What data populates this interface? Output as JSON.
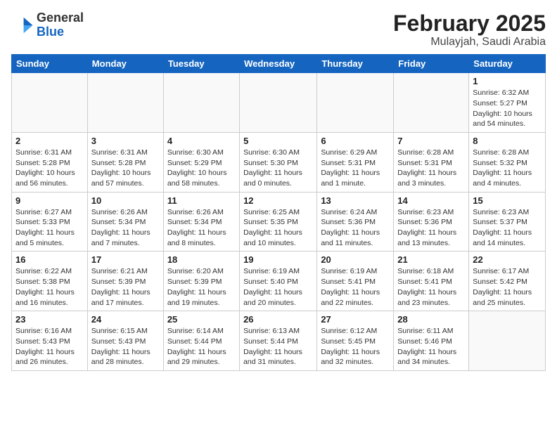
{
  "header": {
    "logo_general": "General",
    "logo_blue": "Blue",
    "title": "February 2025",
    "subtitle": "Mulayjah, Saudi Arabia"
  },
  "days_of_week": [
    "Sunday",
    "Monday",
    "Tuesday",
    "Wednesday",
    "Thursday",
    "Friday",
    "Saturday"
  ],
  "weeks": [
    [
      {
        "day": "",
        "info": ""
      },
      {
        "day": "",
        "info": ""
      },
      {
        "day": "",
        "info": ""
      },
      {
        "day": "",
        "info": ""
      },
      {
        "day": "",
        "info": ""
      },
      {
        "day": "",
        "info": ""
      },
      {
        "day": "1",
        "info": "Sunrise: 6:32 AM\nSunset: 5:27 PM\nDaylight: 10 hours and 54 minutes."
      }
    ],
    [
      {
        "day": "2",
        "info": "Sunrise: 6:31 AM\nSunset: 5:28 PM\nDaylight: 10 hours and 56 minutes."
      },
      {
        "day": "3",
        "info": "Sunrise: 6:31 AM\nSunset: 5:28 PM\nDaylight: 10 hours and 57 minutes."
      },
      {
        "day": "4",
        "info": "Sunrise: 6:30 AM\nSunset: 5:29 PM\nDaylight: 10 hours and 58 minutes."
      },
      {
        "day": "5",
        "info": "Sunrise: 6:30 AM\nSunset: 5:30 PM\nDaylight: 11 hours and 0 minutes."
      },
      {
        "day": "6",
        "info": "Sunrise: 6:29 AM\nSunset: 5:31 PM\nDaylight: 11 hours and 1 minute."
      },
      {
        "day": "7",
        "info": "Sunrise: 6:28 AM\nSunset: 5:31 PM\nDaylight: 11 hours and 3 minutes."
      },
      {
        "day": "8",
        "info": "Sunrise: 6:28 AM\nSunset: 5:32 PM\nDaylight: 11 hours and 4 minutes."
      }
    ],
    [
      {
        "day": "9",
        "info": "Sunrise: 6:27 AM\nSunset: 5:33 PM\nDaylight: 11 hours and 5 minutes."
      },
      {
        "day": "10",
        "info": "Sunrise: 6:26 AM\nSunset: 5:34 PM\nDaylight: 11 hours and 7 minutes."
      },
      {
        "day": "11",
        "info": "Sunrise: 6:26 AM\nSunset: 5:34 PM\nDaylight: 11 hours and 8 minutes."
      },
      {
        "day": "12",
        "info": "Sunrise: 6:25 AM\nSunset: 5:35 PM\nDaylight: 11 hours and 10 minutes."
      },
      {
        "day": "13",
        "info": "Sunrise: 6:24 AM\nSunset: 5:36 PM\nDaylight: 11 hours and 11 minutes."
      },
      {
        "day": "14",
        "info": "Sunrise: 6:23 AM\nSunset: 5:36 PM\nDaylight: 11 hours and 13 minutes."
      },
      {
        "day": "15",
        "info": "Sunrise: 6:23 AM\nSunset: 5:37 PM\nDaylight: 11 hours and 14 minutes."
      }
    ],
    [
      {
        "day": "16",
        "info": "Sunrise: 6:22 AM\nSunset: 5:38 PM\nDaylight: 11 hours and 16 minutes."
      },
      {
        "day": "17",
        "info": "Sunrise: 6:21 AM\nSunset: 5:39 PM\nDaylight: 11 hours and 17 minutes."
      },
      {
        "day": "18",
        "info": "Sunrise: 6:20 AM\nSunset: 5:39 PM\nDaylight: 11 hours and 19 minutes."
      },
      {
        "day": "19",
        "info": "Sunrise: 6:19 AM\nSunset: 5:40 PM\nDaylight: 11 hours and 20 minutes."
      },
      {
        "day": "20",
        "info": "Sunrise: 6:19 AM\nSunset: 5:41 PM\nDaylight: 11 hours and 22 minutes."
      },
      {
        "day": "21",
        "info": "Sunrise: 6:18 AM\nSunset: 5:41 PM\nDaylight: 11 hours and 23 minutes."
      },
      {
        "day": "22",
        "info": "Sunrise: 6:17 AM\nSunset: 5:42 PM\nDaylight: 11 hours and 25 minutes."
      }
    ],
    [
      {
        "day": "23",
        "info": "Sunrise: 6:16 AM\nSunset: 5:43 PM\nDaylight: 11 hours and 26 minutes."
      },
      {
        "day": "24",
        "info": "Sunrise: 6:15 AM\nSunset: 5:43 PM\nDaylight: 11 hours and 28 minutes."
      },
      {
        "day": "25",
        "info": "Sunrise: 6:14 AM\nSunset: 5:44 PM\nDaylight: 11 hours and 29 minutes."
      },
      {
        "day": "26",
        "info": "Sunrise: 6:13 AM\nSunset: 5:44 PM\nDaylight: 11 hours and 31 minutes."
      },
      {
        "day": "27",
        "info": "Sunrise: 6:12 AM\nSunset: 5:45 PM\nDaylight: 11 hours and 32 minutes."
      },
      {
        "day": "28",
        "info": "Sunrise: 6:11 AM\nSunset: 5:46 PM\nDaylight: 11 hours and 34 minutes."
      },
      {
        "day": "",
        "info": ""
      }
    ]
  ]
}
